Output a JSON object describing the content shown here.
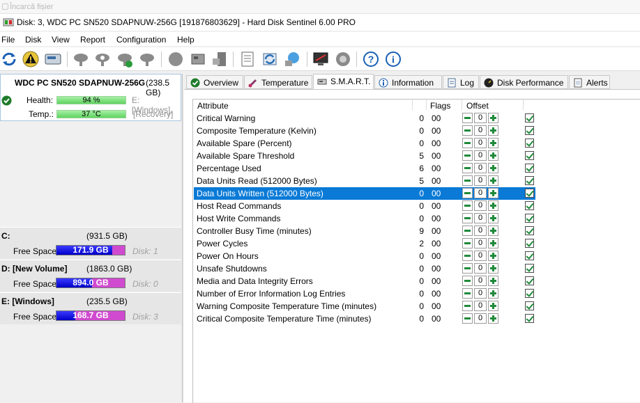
{
  "background_window": {
    "title": "Încarcă fișier"
  },
  "window": {
    "title": "Disk: 3, WDC PC SN520 SDAPNUW-256G [191876803629]  -  Hard Disk Sentinel 6.00 PRO"
  },
  "menu": [
    "File",
    "Disk",
    "View",
    "Report",
    "Configuration",
    "Help"
  ],
  "toolbar": {
    "icons": [
      "refresh-icon",
      "alert-icon",
      "disk-icon",
      "test-icon",
      "test-icon",
      "test-ok-icon",
      "test-icon",
      "blob-icon",
      "hdd-icon",
      "pc-icon",
      "report-icon",
      "send-icon",
      "network-icon",
      "monitor-icon",
      "sound-icon",
      "help-icon",
      "info-icon"
    ]
  },
  "disk": {
    "name": "WDC PC SN520 SDAPNUW-256G",
    "size": "(238.5 GB)",
    "health_label": "Health:",
    "health_value": "94 %",
    "health_percent": 94,
    "temp_label": "Temp.:",
    "temp_value": "37 °C",
    "partition1": "E: [Windows],",
    "partition2": "[Recovery]"
  },
  "volumes": [
    {
      "name": "C:",
      "size": "(931.5 GB)",
      "free_label": "Free Space",
      "free": "171.9 GB",
      "used_fraction": 0.82,
      "disk": "Disk: 1"
    },
    {
      "name": "D: [New Volume]",
      "size": "(1863.0 GB)",
      "free_label": "Free Space",
      "free": "894.0 GB",
      "used_fraction": 0.52,
      "disk": "Disk: 0"
    },
    {
      "name": "E: [Windows]",
      "size": "(235.5 GB)",
      "free_label": "Free Space",
      "free": "168.7 GB",
      "used_fraction": 0.28,
      "disk": "Disk: 3"
    }
  ],
  "tabs": [
    {
      "label": "Overview",
      "icon": "check-icon"
    },
    {
      "label": "Temperature",
      "icon": "thermometer-icon"
    },
    {
      "label": "S.M.A.R.T.",
      "icon": "smart-icon",
      "active": true
    },
    {
      "label": "Information",
      "icon": "info-icon"
    },
    {
      "label": "Log",
      "icon": "log-icon"
    },
    {
      "label": "Disk Performance",
      "icon": "performance-icon"
    },
    {
      "label": "Alerts",
      "icon": "alerts-icon"
    }
  ],
  "smart": {
    "headers": {
      "attribute": "Attribute",
      "flags": "Flags",
      "offset": "Offset"
    },
    "selected_index": 6,
    "rows": [
      {
        "name": "Critical Warning",
        "value": "0",
        "flags": "00",
        "offset": "0"
      },
      {
        "name": "Composite Temperature (Kelvin)",
        "value": "0",
        "flags": "00",
        "offset": "0"
      },
      {
        "name": "Available Spare (Percent)",
        "value": "0",
        "flags": "00",
        "offset": "0"
      },
      {
        "name": "Available Spare Threshold",
        "value": "5",
        "flags": "00",
        "offset": "0"
      },
      {
        "name": "Percentage Used",
        "value": "6",
        "flags": "00",
        "offset": "0"
      },
      {
        "name": "Data Units Read (512000 Bytes)",
        "value": "5",
        "flags": "00",
        "offset": "0"
      },
      {
        "name": "Data Units Written (512000 Bytes)",
        "value": "0",
        "flags": "00",
        "offset": "0"
      },
      {
        "name": "Host Read Commands",
        "value": "0",
        "flags": "00",
        "offset": "0"
      },
      {
        "name": "Host Write Commands",
        "value": "0",
        "flags": "00",
        "offset": "0"
      },
      {
        "name": "Controller Busy Time (minutes)",
        "value": "9",
        "flags": "00",
        "offset": "0"
      },
      {
        "name": "Power Cycles",
        "value": "2",
        "flags": "00",
        "offset": "0"
      },
      {
        "name": "Power On Hours",
        "value": "0",
        "flags": "00",
        "offset": "0"
      },
      {
        "name": "Unsafe Shutdowns",
        "value": "0",
        "flags": "00",
        "offset": "0"
      },
      {
        "name": "Media and Data Integrity Errors",
        "value": "0",
        "flags": "00",
        "offset": "0"
      },
      {
        "name": "Number of Error Information Log Entries",
        "value": "0",
        "flags": "00",
        "offset": "0"
      },
      {
        "name": "Warning Composite Temperature Time (minutes)",
        "value": "0",
        "flags": "00",
        "offset": "0"
      },
      {
        "name": "Critical Composite Temperature Time (minutes)",
        "value": "0",
        "flags": "00",
        "offset": "0"
      }
    ]
  }
}
